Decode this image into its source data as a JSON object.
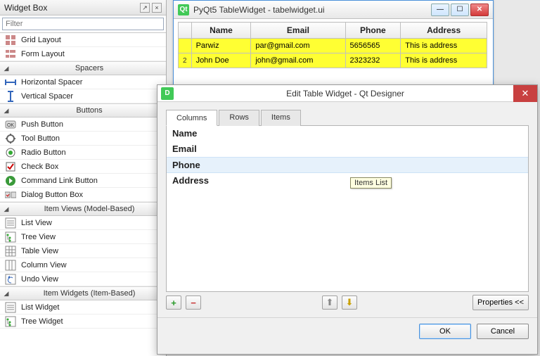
{
  "widgetbox": {
    "title": "Widget Box",
    "pin_icon": "↗",
    "close_icon": "×",
    "filter_placeholder": "Filter",
    "items": [
      {
        "type": "item",
        "icon": "grid",
        "label": "Grid Layout"
      },
      {
        "type": "item",
        "icon": "form",
        "label": "Form Layout"
      },
      {
        "type": "cat",
        "label": "Spacers"
      },
      {
        "type": "item",
        "icon": "hspacer",
        "label": "Horizontal Spacer"
      },
      {
        "type": "item",
        "icon": "vspacer",
        "label": "Vertical Spacer"
      },
      {
        "type": "cat",
        "label": "Buttons"
      },
      {
        "type": "item",
        "icon": "ok",
        "label": "Push Button"
      },
      {
        "type": "item",
        "icon": "tool",
        "label": "Tool Button"
      },
      {
        "type": "item",
        "icon": "radio",
        "label": "Radio Button"
      },
      {
        "type": "item",
        "icon": "check",
        "label": "Check Box"
      },
      {
        "type": "item",
        "icon": "cmdlink",
        "label": "Command Link Button"
      },
      {
        "type": "item",
        "icon": "dlgbb",
        "label": "Dialog Button Box"
      },
      {
        "type": "cat",
        "label": "Item Views (Model-Based)"
      },
      {
        "type": "item",
        "icon": "list",
        "label": "List View"
      },
      {
        "type": "item",
        "icon": "tree",
        "label": "Tree View"
      },
      {
        "type": "item",
        "icon": "table",
        "label": "Table View"
      },
      {
        "type": "item",
        "icon": "column",
        "label": "Column View"
      },
      {
        "type": "item",
        "icon": "undo",
        "label": "Undo View"
      },
      {
        "type": "cat",
        "label": "Item Widgets (Item-Based)"
      },
      {
        "type": "item",
        "icon": "list",
        "label": "List Widget"
      },
      {
        "type": "item",
        "icon": "tree",
        "label": "Tree Widget"
      }
    ]
  },
  "preview": {
    "title": "PyQt5 TableWidget - tabelwidget.ui",
    "headers": [
      "Name",
      "Email",
      "Phone",
      "Address"
    ],
    "rows": [
      {
        "num": "",
        "cells": [
          "Parwiz",
          "par@gmail.com",
          "5656565",
          "This is address"
        ],
        "red": true
      },
      {
        "num": "2",
        "cells": [
          "John Doe",
          "john@gmail.com",
          "2323232",
          "This is address"
        ],
        "red": false
      }
    ]
  },
  "dialog": {
    "title": "Edit Table Widget - Qt Designer",
    "tabs": [
      "Columns",
      "Rows",
      "Items"
    ],
    "active_tab": 0,
    "columns": [
      "Name",
      "Email",
      "Phone",
      "Address"
    ],
    "selected_index": 2,
    "tooltip": "Items List",
    "add": "+",
    "remove": "−",
    "up": "▲",
    "down": "▼",
    "properties": "Properties <<",
    "ok": "OK",
    "cancel": "Cancel"
  }
}
